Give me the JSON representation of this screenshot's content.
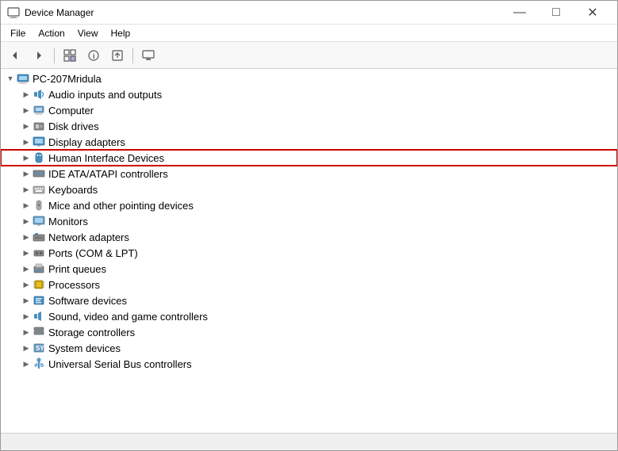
{
  "window": {
    "title": "Device Manager",
    "controls": {
      "minimize": "—",
      "maximize": "□",
      "close": "✕"
    }
  },
  "menubar": {
    "items": [
      {
        "id": "file",
        "label": "File"
      },
      {
        "id": "action",
        "label": "Action"
      },
      {
        "id": "view",
        "label": "View"
      },
      {
        "id": "help",
        "label": "Help"
      }
    ]
  },
  "toolbar": {
    "buttons": [
      {
        "id": "back",
        "icon": "◀",
        "label": "Back"
      },
      {
        "id": "forward",
        "icon": "▶",
        "label": "Forward"
      },
      {
        "id": "show-hidden",
        "icon": "⊞",
        "label": "Show/Hide"
      },
      {
        "id": "properties",
        "icon": "ℹ",
        "label": "Properties"
      },
      {
        "id": "update-driver",
        "icon": "↑",
        "label": "Update Driver"
      },
      {
        "id": "display",
        "icon": "🖥",
        "label": "Display"
      }
    ]
  },
  "tree": {
    "root": {
      "label": "PC-207Mridula",
      "expanded": true
    },
    "items": [
      {
        "id": "audio",
        "label": "Audio inputs and outputs",
        "indent": 1,
        "icon": "audio",
        "expanded": false
      },
      {
        "id": "computer",
        "label": "Computer",
        "indent": 1,
        "icon": "computer",
        "expanded": false
      },
      {
        "id": "disk",
        "label": "Disk drives",
        "indent": 1,
        "icon": "disk",
        "expanded": false
      },
      {
        "id": "display",
        "label": "Display adapters",
        "indent": 1,
        "icon": "display",
        "expanded": false
      },
      {
        "id": "hid",
        "label": "Human Interface Devices",
        "indent": 1,
        "icon": "hid",
        "expanded": false,
        "highlighted": true
      },
      {
        "id": "ide",
        "label": "IDE ATA/ATAPI controllers",
        "indent": 1,
        "icon": "ide",
        "expanded": false
      },
      {
        "id": "keyboards",
        "label": "Keyboards",
        "indent": 1,
        "icon": "keyboard",
        "expanded": false
      },
      {
        "id": "mice",
        "label": "Mice and other pointing devices",
        "indent": 1,
        "icon": "mouse",
        "expanded": false
      },
      {
        "id": "monitors",
        "label": "Monitors",
        "indent": 1,
        "icon": "monitor",
        "expanded": false
      },
      {
        "id": "network",
        "label": "Network adapters",
        "indent": 1,
        "icon": "network",
        "expanded": false
      },
      {
        "id": "ports",
        "label": "Ports (COM & LPT)",
        "indent": 1,
        "icon": "ports",
        "expanded": false
      },
      {
        "id": "print",
        "label": "Print queues",
        "indent": 1,
        "icon": "print",
        "expanded": false
      },
      {
        "id": "processors",
        "label": "Processors",
        "indent": 1,
        "icon": "processor",
        "expanded": false
      },
      {
        "id": "software",
        "label": "Software devices",
        "indent": 1,
        "icon": "software",
        "expanded": false
      },
      {
        "id": "sound",
        "label": "Sound, video and game controllers",
        "indent": 1,
        "icon": "sound",
        "expanded": false
      },
      {
        "id": "storage",
        "label": "Storage controllers",
        "indent": 1,
        "icon": "storage",
        "expanded": false
      },
      {
        "id": "system",
        "label": "System devices",
        "indent": 1,
        "icon": "system",
        "expanded": false
      },
      {
        "id": "usb",
        "label": "Universal Serial Bus controllers",
        "indent": 1,
        "icon": "usb",
        "expanded": false
      }
    ]
  },
  "statusbar": {
    "text": ""
  }
}
